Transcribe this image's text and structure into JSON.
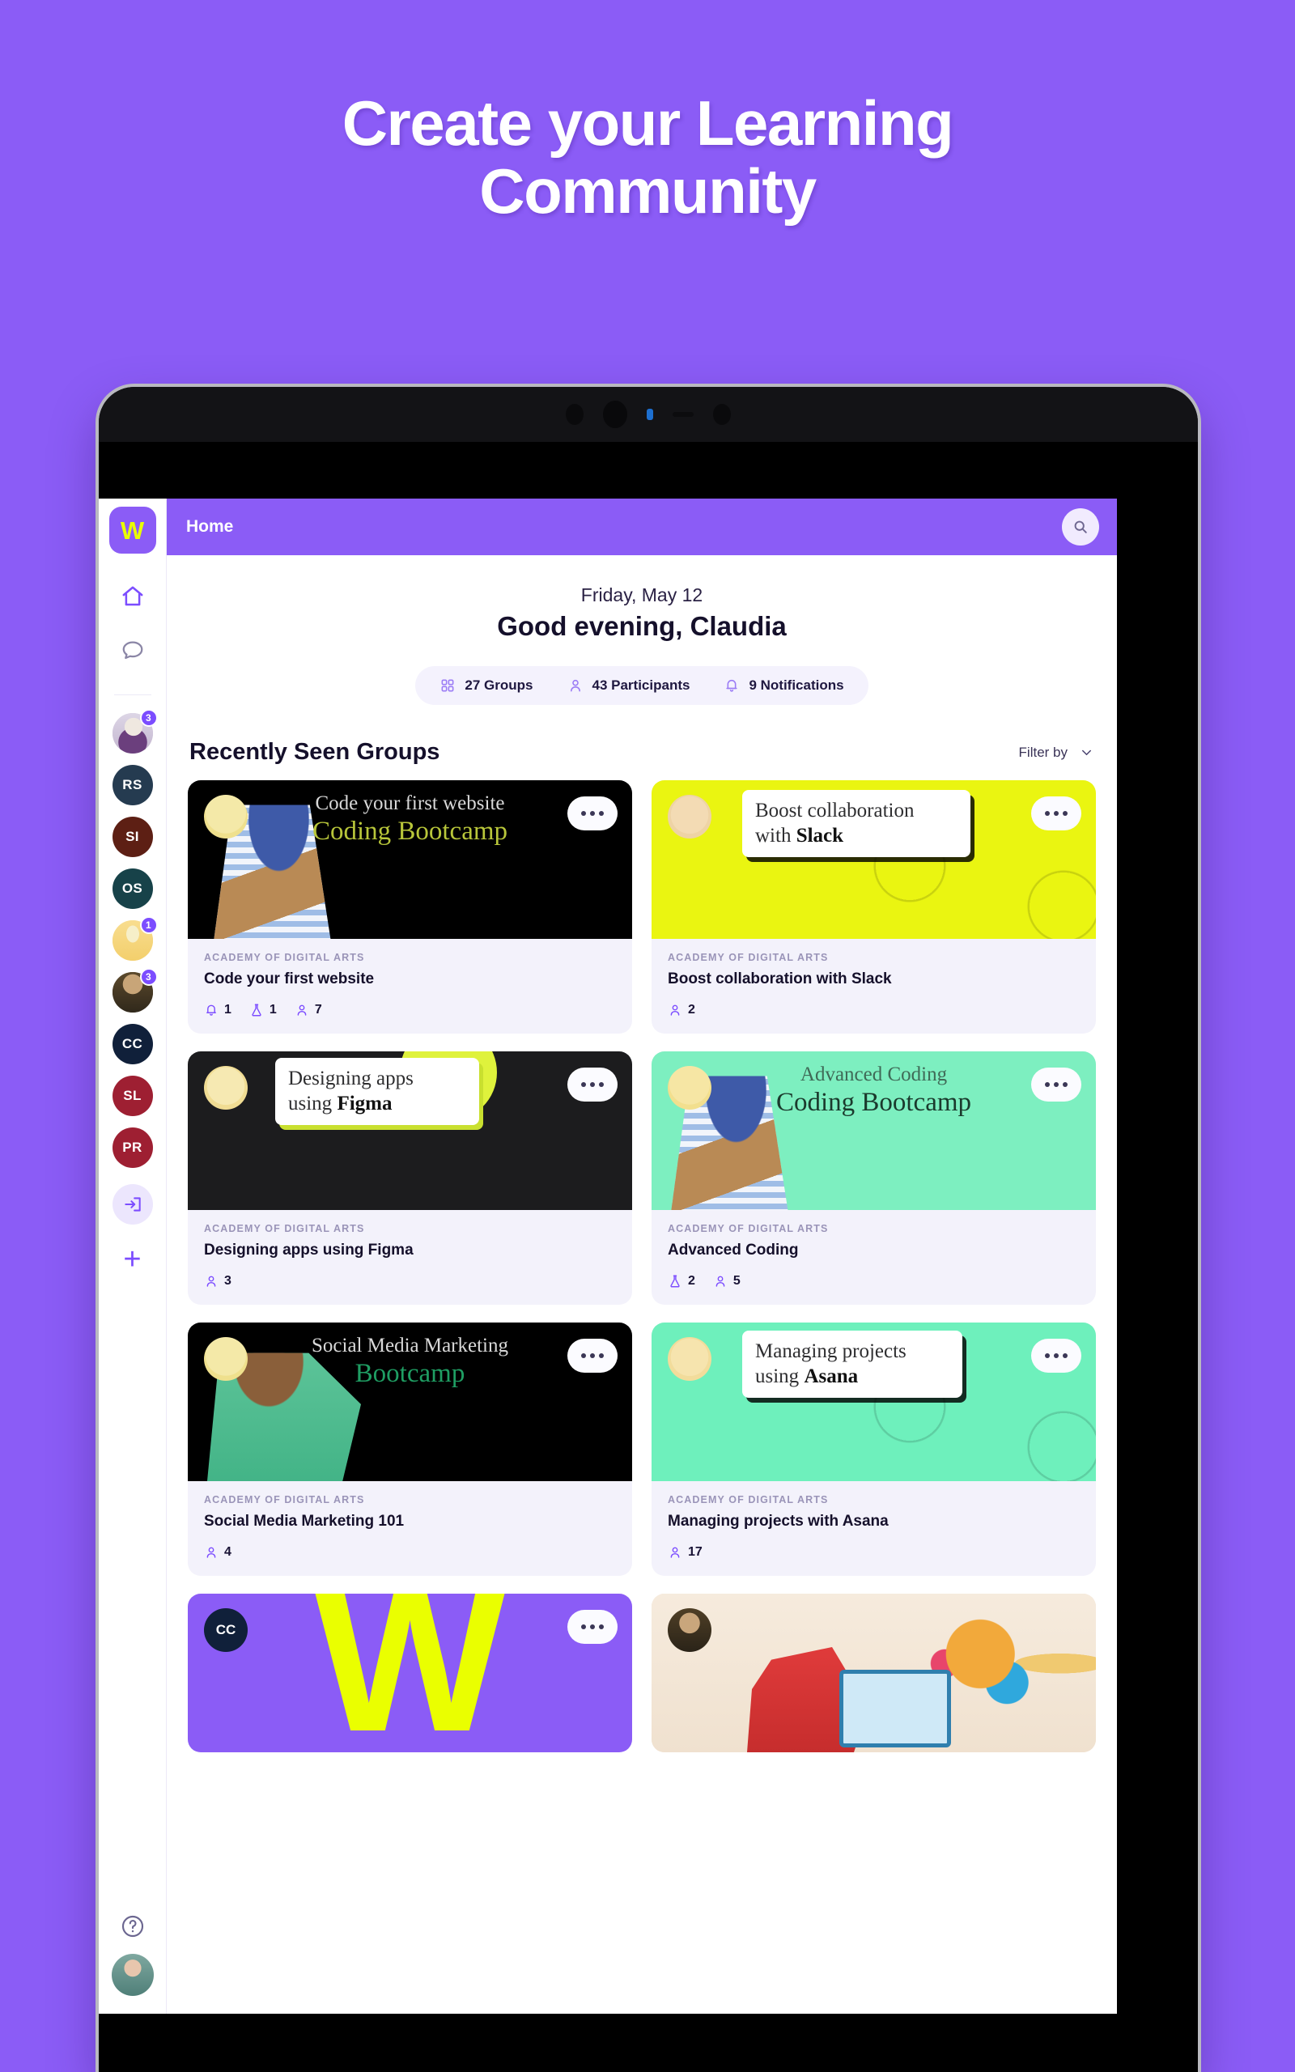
{
  "promo": {
    "line1": "Create your Learning",
    "line2": "Community"
  },
  "app": {
    "logo_letter": "W",
    "topbar": {
      "title": "Home",
      "search_icon": "search-icon"
    },
    "accent": "#8b5cf6",
    "logo_color": "#eaff00"
  },
  "greeting": {
    "date": "Friday, May 12",
    "message": "Good evening, Claudia"
  },
  "stats": [
    {
      "icon": "grid-icon",
      "label": "27 Groups"
    },
    {
      "icon": "person-icon",
      "label": "43 Participants"
    },
    {
      "icon": "bell-icon",
      "label": "9 Notifications"
    }
  ],
  "section": {
    "title": "Recently Seen Groups",
    "filter_label": "Filter by",
    "filter_icon": "chevron-down-icon"
  },
  "sidebar": {
    "nav": [
      {
        "name": "home",
        "icon": "home-icon",
        "active": true
      },
      {
        "name": "messages",
        "icon": "chat-bubble-icon",
        "active": false
      }
    ],
    "groups": [
      {
        "initials": "",
        "type": "photo",
        "color": "#cfc4d8",
        "badge": "3"
      },
      {
        "initials": "RS",
        "type": "initials",
        "color": "#253b50",
        "badge": ""
      },
      {
        "initials": "SI",
        "type": "initials",
        "color": "#5d1f14",
        "badge": ""
      },
      {
        "initials": "OS",
        "type": "initials",
        "color": "#174249",
        "badge": ""
      },
      {
        "initials": "",
        "type": "photo",
        "color": "#f7d98a",
        "badge": "1"
      },
      {
        "initials": "",
        "type": "photo",
        "color": "#4a3b24",
        "badge": "3"
      },
      {
        "initials": "CC",
        "type": "initials",
        "color": "#10203a",
        "badge": ""
      },
      {
        "initials": "SL",
        "type": "initials",
        "color": "#9e1f32",
        "badge": ""
      },
      {
        "initials": "PR",
        "type": "initials",
        "color": "#9e1f32",
        "badge": ""
      }
    ],
    "join_icon": "enter-arrow-icon",
    "add_icon": "plus-icon",
    "help_icon": "help-circle-icon",
    "profile_icon": "user-avatar"
  },
  "cards": [
    {
      "org": "ACADEMY OF DIGITAL ARTS",
      "name": "Code your first website",
      "cover_style": "dark-portrait",
      "cover_bg": "#000000",
      "cover_line1": "Code your first website",
      "cover_line2": "Coding Bootcamp",
      "cover_line1_color": "#d8d8d8",
      "cover_line2_color": "#b8c63a",
      "counts": [
        {
          "icon": "bell-icon",
          "value": "1"
        },
        {
          "icon": "flask-icon",
          "value": "1"
        },
        {
          "icon": "person-icon",
          "value": "7"
        }
      ]
    },
    {
      "org": "ACADEMY OF DIGITAL ARTS",
      "name": "Boost collaboration with Slack",
      "cover_style": "chat-bubble",
      "cover_bg": "#eaf511",
      "chat_line1": "Boost collaboration",
      "chat_line2_prefix": "with ",
      "chat_line2_bold": "Slack",
      "counts": [
        {
          "icon": "person-icon",
          "value": "2"
        }
      ]
    },
    {
      "org": "ACADEMY OF DIGITAL ARTS",
      "name": "Designing apps using Figma",
      "cover_style": "chat-bubble-dark",
      "cover_bg": "#1c1c1e",
      "chat_line1": "Designing apps",
      "chat_line2_prefix": "using ",
      "chat_line2_bold": "Figma",
      "counts": [
        {
          "icon": "person-icon",
          "value": "3"
        }
      ]
    },
    {
      "org": "ACADEMY OF DIGITAL ARTS",
      "name": "Advanced Coding",
      "cover_style": "mint-portrait",
      "cover_bg": "#7defc0",
      "cover_line1": "Advanced Coding",
      "cover_line2": "Coding Bootcamp",
      "cover_line1_color": "#3f6a57",
      "cover_line2_color": "#1b3a2d",
      "counts": [
        {
          "icon": "flask-icon",
          "value": "2"
        },
        {
          "icon": "person-icon",
          "value": "5"
        }
      ]
    },
    {
      "org": "ACADEMY OF DIGITAL ARTS",
      "name": "Social Media Marketing 101",
      "cover_style": "dark-portrait-2",
      "cover_bg": "#000000",
      "cover_line1": "Social Media Marketing",
      "cover_line2": "Bootcamp",
      "cover_line1_color": "#d8d8d8",
      "cover_line2_color": "#1f9e63",
      "counts": [
        {
          "icon": "person-icon",
          "value": "4"
        }
      ]
    },
    {
      "org": "ACADEMY OF DIGITAL ARTS",
      "name": "Managing projects with Asana",
      "cover_style": "chat-bubble",
      "cover_bg": "#6ef0bc",
      "chat_line1": "Managing projects",
      "chat_line2_prefix": "using ",
      "chat_line2_bold": "Asana",
      "counts": [
        {
          "icon": "person-icon",
          "value": "17"
        }
      ]
    }
  ],
  "partial_cards": [
    {
      "cover_style": "w-logo",
      "cover_bg": "#8b5cf6",
      "avatar_initials": "CC",
      "logo_letter": "W"
    },
    {
      "cover_style": "illustration",
      "cover_bg": "#f3e6d8"
    }
  ]
}
